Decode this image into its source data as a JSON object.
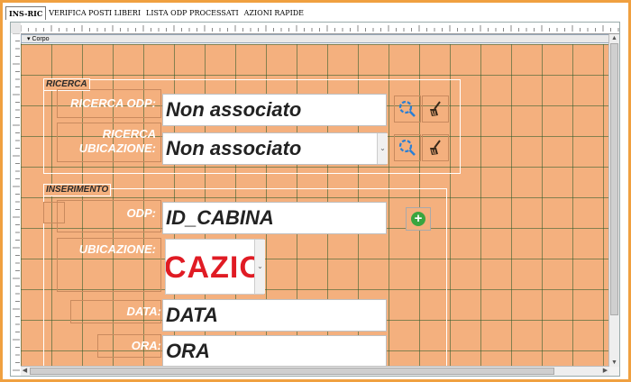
{
  "tabs": [
    {
      "label": "INS-RIC",
      "active": true
    },
    {
      "label": "VERIFICA POSTI LIBERI",
      "active": false
    },
    {
      "label": "LISTA ODP PROCESSATI",
      "active": false
    },
    {
      "label": "AZIONI RAPIDE",
      "active": false
    }
  ],
  "section": {
    "label": "Corpo"
  },
  "ricerca": {
    "group_label": "RICERCA",
    "odp_label": "RICERCA ODP:",
    "odp_value": "Non associato",
    "ubicazione_label": "RICERCA UBICAZIONE:",
    "ubicazione_value": "Non associato"
  },
  "inserimento": {
    "group_label": "INSERIMENTO",
    "odp_label": "ODP:",
    "odp_value": "ID_CABINA",
    "ubicazione_label": "UBICAZIONE:",
    "ubicazione_value": "CAZIO",
    "data_label": "DATA:",
    "data_value": "DATA",
    "ora_label": "ORA:",
    "ora_value": "ORA"
  },
  "icons": {
    "search": "search-icon",
    "clear": "broom-clear-icon",
    "add": "add-plus-icon"
  },
  "colors": {
    "background": "#f4b07e",
    "grid": "#285a28",
    "label_text": "#ffffff",
    "add_button": "#3aa53f",
    "ubicazione_text": "#e01b24",
    "search_icon": "#2a7fd4"
  }
}
